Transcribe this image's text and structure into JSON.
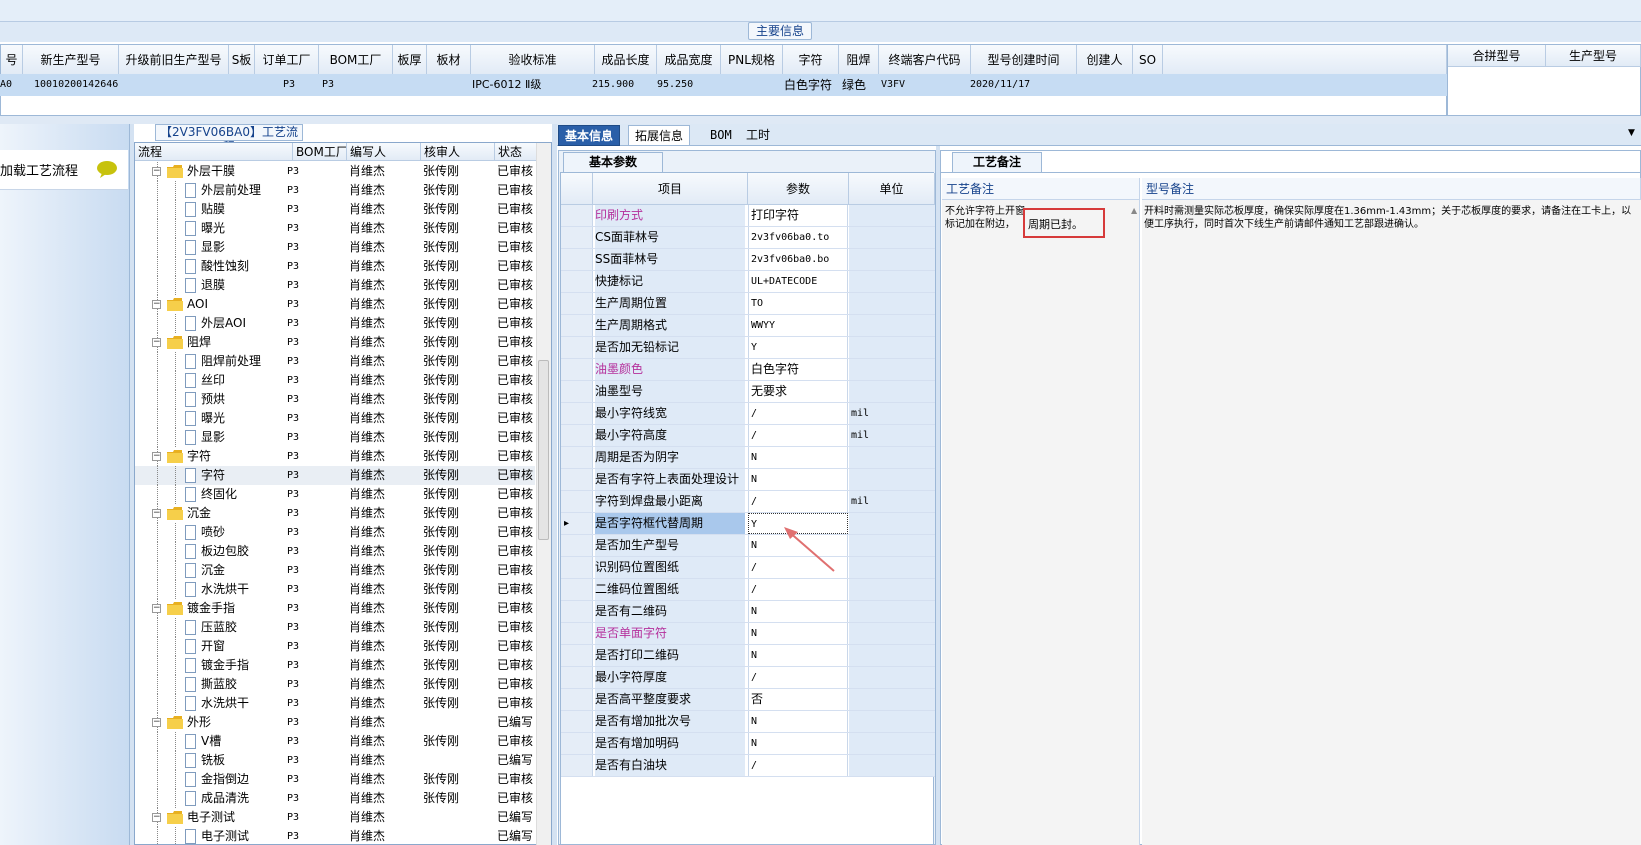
{
  "main_info": {
    "section_title": "主要信息",
    "columns": [
      "号",
      "新生产型号",
      "升级前旧生产型号",
      "S板",
      "订单工厂",
      "BOM工厂",
      "板厚",
      "板材",
      "验收标准",
      "成品长度",
      "成品宽度",
      "PNL规格",
      "字符",
      "阻焊",
      "终端客户代码",
      "型号创建时间",
      "创建人",
      "SO"
    ],
    "row": [
      "A0",
      "10010200142646",
      "",
      "",
      "P3",
      "P3",
      "",
      "",
      "IPC-6012 Ⅱ级",
      "215.900",
      "95.250",
      "",
      "白色字符",
      "绿色",
      "V3FV",
      "2020/11/17",
      "",
      ""
    ],
    "right_columns": [
      "合拼型号",
      "生产型号"
    ]
  },
  "left_panel": {
    "load_process_label": "加载工艺流程"
  },
  "process_tree": {
    "title": "【2V3FV06BA0】工艺流程",
    "columns": [
      "流程",
      "BOM工厂",
      "编写人",
      "核审人",
      "状态"
    ],
    "rows": [
      {
        "type": "group",
        "name": "外层干膜",
        "bom": "P3",
        "writer": "肖维杰",
        "reviewer": "张传刚",
        "status": "已审核"
      },
      {
        "type": "item",
        "name": "外层前处理",
        "bom": "P3",
        "writer": "肖维杰",
        "reviewer": "张传刚",
        "status": "已审核"
      },
      {
        "type": "item",
        "name": "贴膜",
        "bom": "P3",
        "writer": "肖维杰",
        "reviewer": "张传刚",
        "status": "已审核"
      },
      {
        "type": "item",
        "name": "曝光",
        "bom": "P3",
        "writer": "肖维杰",
        "reviewer": "张传刚",
        "status": "已审核"
      },
      {
        "type": "item",
        "name": "显影",
        "bom": "P3",
        "writer": "肖维杰",
        "reviewer": "张传刚",
        "status": "已审核"
      },
      {
        "type": "item",
        "name": "酸性蚀刻",
        "bom": "P3",
        "writer": "肖维杰",
        "reviewer": "张传刚",
        "status": "已审核"
      },
      {
        "type": "item",
        "name": "退膜",
        "bom": "P3",
        "writer": "肖维杰",
        "reviewer": "张传刚",
        "status": "已审核"
      },
      {
        "type": "group",
        "name": "AOI",
        "bom": "P3",
        "writer": "肖维杰",
        "reviewer": "张传刚",
        "status": "已审核"
      },
      {
        "type": "item",
        "name": "外层AOI",
        "bom": "P3",
        "writer": "肖维杰",
        "reviewer": "张传刚",
        "status": "已审核"
      },
      {
        "type": "group",
        "name": "阻焊",
        "bom": "P3",
        "writer": "肖维杰",
        "reviewer": "张传刚",
        "status": "已审核"
      },
      {
        "type": "item",
        "name": "阻焊前处理",
        "bom": "P3",
        "writer": "肖维杰",
        "reviewer": "张传刚",
        "status": "已审核"
      },
      {
        "type": "item",
        "name": "丝印",
        "bom": "P3",
        "writer": "肖维杰",
        "reviewer": "张传刚",
        "status": "已审核"
      },
      {
        "type": "item",
        "name": "预烘",
        "bom": "P3",
        "writer": "肖维杰",
        "reviewer": "张传刚",
        "status": "已审核"
      },
      {
        "type": "item",
        "name": "曝光",
        "bom": "P3",
        "writer": "肖维杰",
        "reviewer": "张传刚",
        "status": "已审核"
      },
      {
        "type": "item",
        "name": "显影",
        "bom": "P3",
        "writer": "肖维杰",
        "reviewer": "张传刚",
        "status": "已审核"
      },
      {
        "type": "group",
        "name": "字符",
        "bom": "P3",
        "writer": "肖维杰",
        "reviewer": "张传刚",
        "status": "已审核"
      },
      {
        "type": "item",
        "name": "字符",
        "bom": "P3",
        "writer": "肖维杰",
        "reviewer": "张传刚",
        "status": "已审核",
        "selected": true
      },
      {
        "type": "item",
        "name": "终固化",
        "bom": "P3",
        "writer": "肖维杰",
        "reviewer": "张传刚",
        "status": "已审核"
      },
      {
        "type": "group",
        "name": "沉金",
        "bom": "P3",
        "writer": "肖维杰",
        "reviewer": "张传刚",
        "status": "已审核"
      },
      {
        "type": "item",
        "name": "喷砂",
        "bom": "P3",
        "writer": "肖维杰",
        "reviewer": "张传刚",
        "status": "已审核"
      },
      {
        "type": "item",
        "name": "板边包胶",
        "bom": "P3",
        "writer": "肖维杰",
        "reviewer": "张传刚",
        "status": "已审核"
      },
      {
        "type": "item",
        "name": "沉金",
        "bom": "P3",
        "writer": "肖维杰",
        "reviewer": "张传刚",
        "status": "已审核"
      },
      {
        "type": "item",
        "name": "水洗烘干",
        "bom": "P3",
        "writer": "肖维杰",
        "reviewer": "张传刚",
        "status": "已审核"
      },
      {
        "type": "group",
        "name": "镀金手指",
        "bom": "P3",
        "writer": "肖维杰",
        "reviewer": "张传刚",
        "status": "已审核"
      },
      {
        "type": "item",
        "name": "压蓝胶",
        "bom": "P3",
        "writer": "肖维杰",
        "reviewer": "张传刚",
        "status": "已审核"
      },
      {
        "type": "item",
        "name": "开窗",
        "bom": "P3",
        "writer": "肖维杰",
        "reviewer": "张传刚",
        "status": "已审核"
      },
      {
        "type": "item",
        "name": "镀金手指",
        "bom": "P3",
        "writer": "肖维杰",
        "reviewer": "张传刚",
        "status": "已审核"
      },
      {
        "type": "item",
        "name": "撕蓝胶",
        "bom": "P3",
        "writer": "肖维杰",
        "reviewer": "张传刚",
        "status": "已审核"
      },
      {
        "type": "item",
        "name": "水洗烘干",
        "bom": "P3",
        "writer": "肖维杰",
        "reviewer": "张传刚",
        "status": "已审核"
      },
      {
        "type": "group",
        "name": "外形",
        "bom": "P3",
        "writer": "肖维杰",
        "reviewer": "",
        "status": "已编写"
      },
      {
        "type": "item",
        "name": "V槽",
        "bom": "P3",
        "writer": "肖维杰",
        "reviewer": "张传刚",
        "status": "已审核"
      },
      {
        "type": "item",
        "name": "铣板",
        "bom": "P3",
        "writer": "肖维杰",
        "reviewer": "",
        "status": "已编写"
      },
      {
        "type": "item",
        "name": "金指倒边",
        "bom": "P3",
        "writer": "肖维杰",
        "reviewer": "张传刚",
        "status": "已审核"
      },
      {
        "type": "item",
        "name": "成品清洗",
        "bom": "P3",
        "writer": "肖维杰",
        "reviewer": "张传刚",
        "status": "已审核"
      },
      {
        "type": "group",
        "name": "电子测试",
        "bom": "P3",
        "writer": "肖维杰",
        "reviewer": "",
        "status": "已编写"
      },
      {
        "type": "item",
        "name": "电子测试",
        "bom": "P3",
        "writer": "肖维杰",
        "reviewer": "",
        "status": "已编写"
      }
    ]
  },
  "tabs": [
    "基本信息",
    "拓展信息",
    "BOM",
    "工时"
  ],
  "basic_params": {
    "sub_tab": "基本参数",
    "columns": [
      "项目",
      "参数",
      "单位"
    ],
    "rows": [
      {
        "name": "印刷方式",
        "value": "打印字符",
        "unit": "",
        "pink": true
      },
      {
        "name": "CS面菲林号",
        "value": "2v3fv06ba0.to",
        "unit": ""
      },
      {
        "name": "SS面菲林号",
        "value": "2v3fv06ba0.bo",
        "unit": ""
      },
      {
        "name": "快捷标记",
        "value": "UL+DATECODE",
        "unit": ""
      },
      {
        "name": "生产周期位置",
        "value": "TO",
        "unit": ""
      },
      {
        "name": "生产周期格式",
        "value": "WWYY",
        "unit": ""
      },
      {
        "name": "是否加无铅标记",
        "value": "Y",
        "unit": ""
      },
      {
        "name": "油墨颜色",
        "value": "白色字符",
        "unit": "",
        "pink": true
      },
      {
        "name": "油墨型号",
        "value": "无要求",
        "unit": ""
      },
      {
        "name": "最小字符线宽",
        "value": "/",
        "unit": "mil"
      },
      {
        "name": "最小字符高度",
        "value": "/",
        "unit": "mil"
      },
      {
        "name": "周期是否为阴字",
        "value": "N",
        "unit": ""
      },
      {
        "name": "是否有字符上表面处理设计",
        "value": "N",
        "unit": ""
      },
      {
        "name": "字符到焊盘最小距离",
        "value": "/",
        "unit": "mil"
      },
      {
        "name": "是否字符框代替周期",
        "value": "Y",
        "unit": "",
        "selected": true
      },
      {
        "name": "是否加生产型号",
        "value": "N",
        "unit": ""
      },
      {
        "name": "识别码位置图纸",
        "value": "/",
        "unit": ""
      },
      {
        "name": "二维码位置图纸",
        "value": "/",
        "unit": ""
      },
      {
        "name": "是否有二维码",
        "value": "N",
        "unit": ""
      },
      {
        "name": "是否单面字符",
        "value": "N",
        "unit": "",
        "pink": true
      },
      {
        "name": "是否打印二维码",
        "value": "N",
        "unit": ""
      },
      {
        "name": "最小字符厚度",
        "value": "/",
        "unit": ""
      },
      {
        "name": "是否高平整度要求",
        "value": "否",
        "unit": ""
      },
      {
        "name": "是否有增加批次号",
        "value": "N",
        "unit": ""
      },
      {
        "name": "是否有增加明码",
        "value": "N",
        "unit": ""
      },
      {
        "name": "是否有白油块",
        "value": "/",
        "unit": ""
      }
    ]
  },
  "process_notes": {
    "sub_tab": "工艺备注",
    "col1_header": "工艺备注",
    "col2_header": "型号备注",
    "col1_text_line1": "不允许字符上开窗",
    "col1_text_line2": "标记加在附边，",
    "col1_highlight": "周期已封。",
    "col2_text": "开料时需测量实际芯板厚度，确保实际厚度在1.36mm-1.43mm；关于芯板厚度的要求，请备注在工卡上，以便工序执行，同时首次下线生产前请邮件通知工艺部跟进确认。"
  },
  "colors": {
    "accent": "#2a5fa8",
    "highlight_border": "#d63a3a",
    "annotation_arrow": "#e07070",
    "folder": "#f0c030",
    "pink_label": "#b5309c",
    "bubble": "#c7c20d"
  }
}
